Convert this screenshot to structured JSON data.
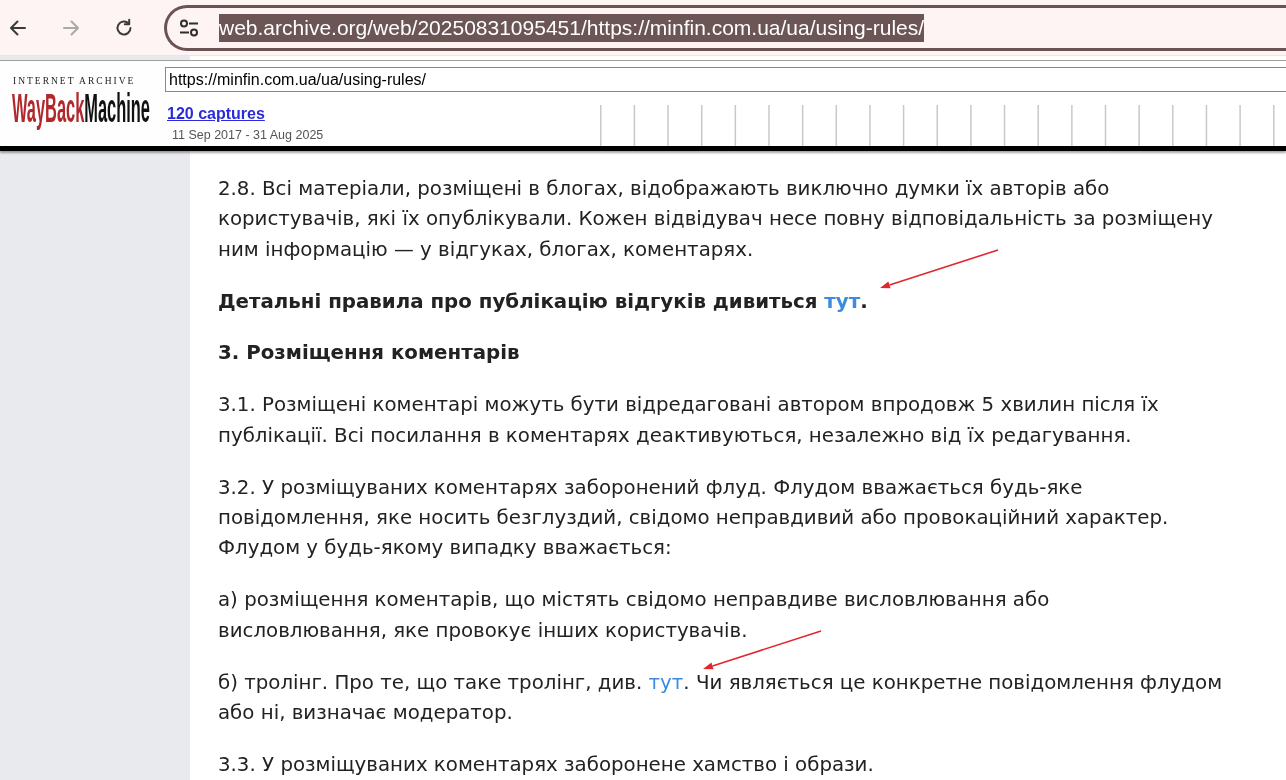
{
  "browser": {
    "nav_buttons": [
      {
        "kind": "back",
        "disabled": false
      },
      {
        "kind": "forward",
        "disabled": true
      },
      {
        "kind": "reload",
        "disabled": false
      }
    ],
    "address_bar": {
      "url": "web.archive.org/web/20250831095451/https://minfin.com.ua/ua/using-rules/",
      "selected": true
    }
  },
  "wayback_toolbar": {
    "logo": {
      "caption": "INTERNET ARCHIVE",
      "wordmark_first": "WayBack",
      "wordmark_second": "Machine"
    },
    "url_field": {
      "value": "https://minfin.com.ua/ua/using-rules/"
    },
    "captures_link": "120 captures",
    "date_range": "11 Sep 2017 - 31 Aug 2025"
  },
  "article": {
    "paragraphs": [
      {
        "kind": "paragraph",
        "bold": false,
        "parts": [
          {
            "kind": "text",
            "text": "2.8. Всі матеріали, розміщені в блогах, відображають виключно думки їх авторів або\nкористувачів, які їх опублікували. Кожен відвідувач несе повну відповідальність за розміщену\nним інформацію — у відгуках, блогах, коментарях."
          }
        ]
      },
      {
        "kind": "paragraph",
        "bold": true,
        "parts": [
          {
            "kind": "text",
            "text": "Детальні правила про публікацію відгуків дивиться "
          },
          {
            "kind": "link",
            "text": "тут",
            "arrow": true
          },
          {
            "kind": "text",
            "text": "."
          }
        ]
      },
      {
        "kind": "heading",
        "text": "3. Розміщення коментарів"
      },
      {
        "kind": "paragraph",
        "bold": false,
        "parts": [
          {
            "kind": "text",
            "text": "3.1. Розміщені коментарі можуть бути відредаговані автором впродовж 5 хвилин після їх\nпублікації. Всі посилання в коментарях деактивуються, незалежно від їх редагування."
          }
        ]
      },
      {
        "kind": "paragraph",
        "bold": false,
        "parts": [
          {
            "kind": "text",
            "text": "3.2. У розміщуваних коментарях заборонений флуд. Флудом вважається будь-яке\nповідомлення, яке носить безглуздий, свідомо неправдивий або провокаційний характер.\nФлудом у будь-якому випадку вважається:"
          }
        ]
      },
      {
        "kind": "paragraph",
        "bold": false,
        "parts": [
          {
            "kind": "text",
            "text": "а) розміщення коментарів, що містять свідомо неправдиве висловлювання або\nвисловлювання, яке провокує інших користувачів."
          }
        ]
      },
      {
        "kind": "paragraph",
        "bold": false,
        "parts": [
          {
            "kind": "text",
            "text": "б) тролінг. Про те, що таке тролінг, див. "
          },
          {
            "kind": "link",
            "text": "тут",
            "arrow": true
          },
          {
            "kind": "text",
            "text": ". Чи являється це конкретне повідомлення флудом\nабо ні, визначає модератор."
          }
        ]
      },
      {
        "kind": "paragraph",
        "bold": false,
        "parts": [
          {
            "kind": "text",
            "text": "3.3. У розміщуваних коментарях заборонене хамство і образи."
          }
        ]
      }
    ]
  }
}
